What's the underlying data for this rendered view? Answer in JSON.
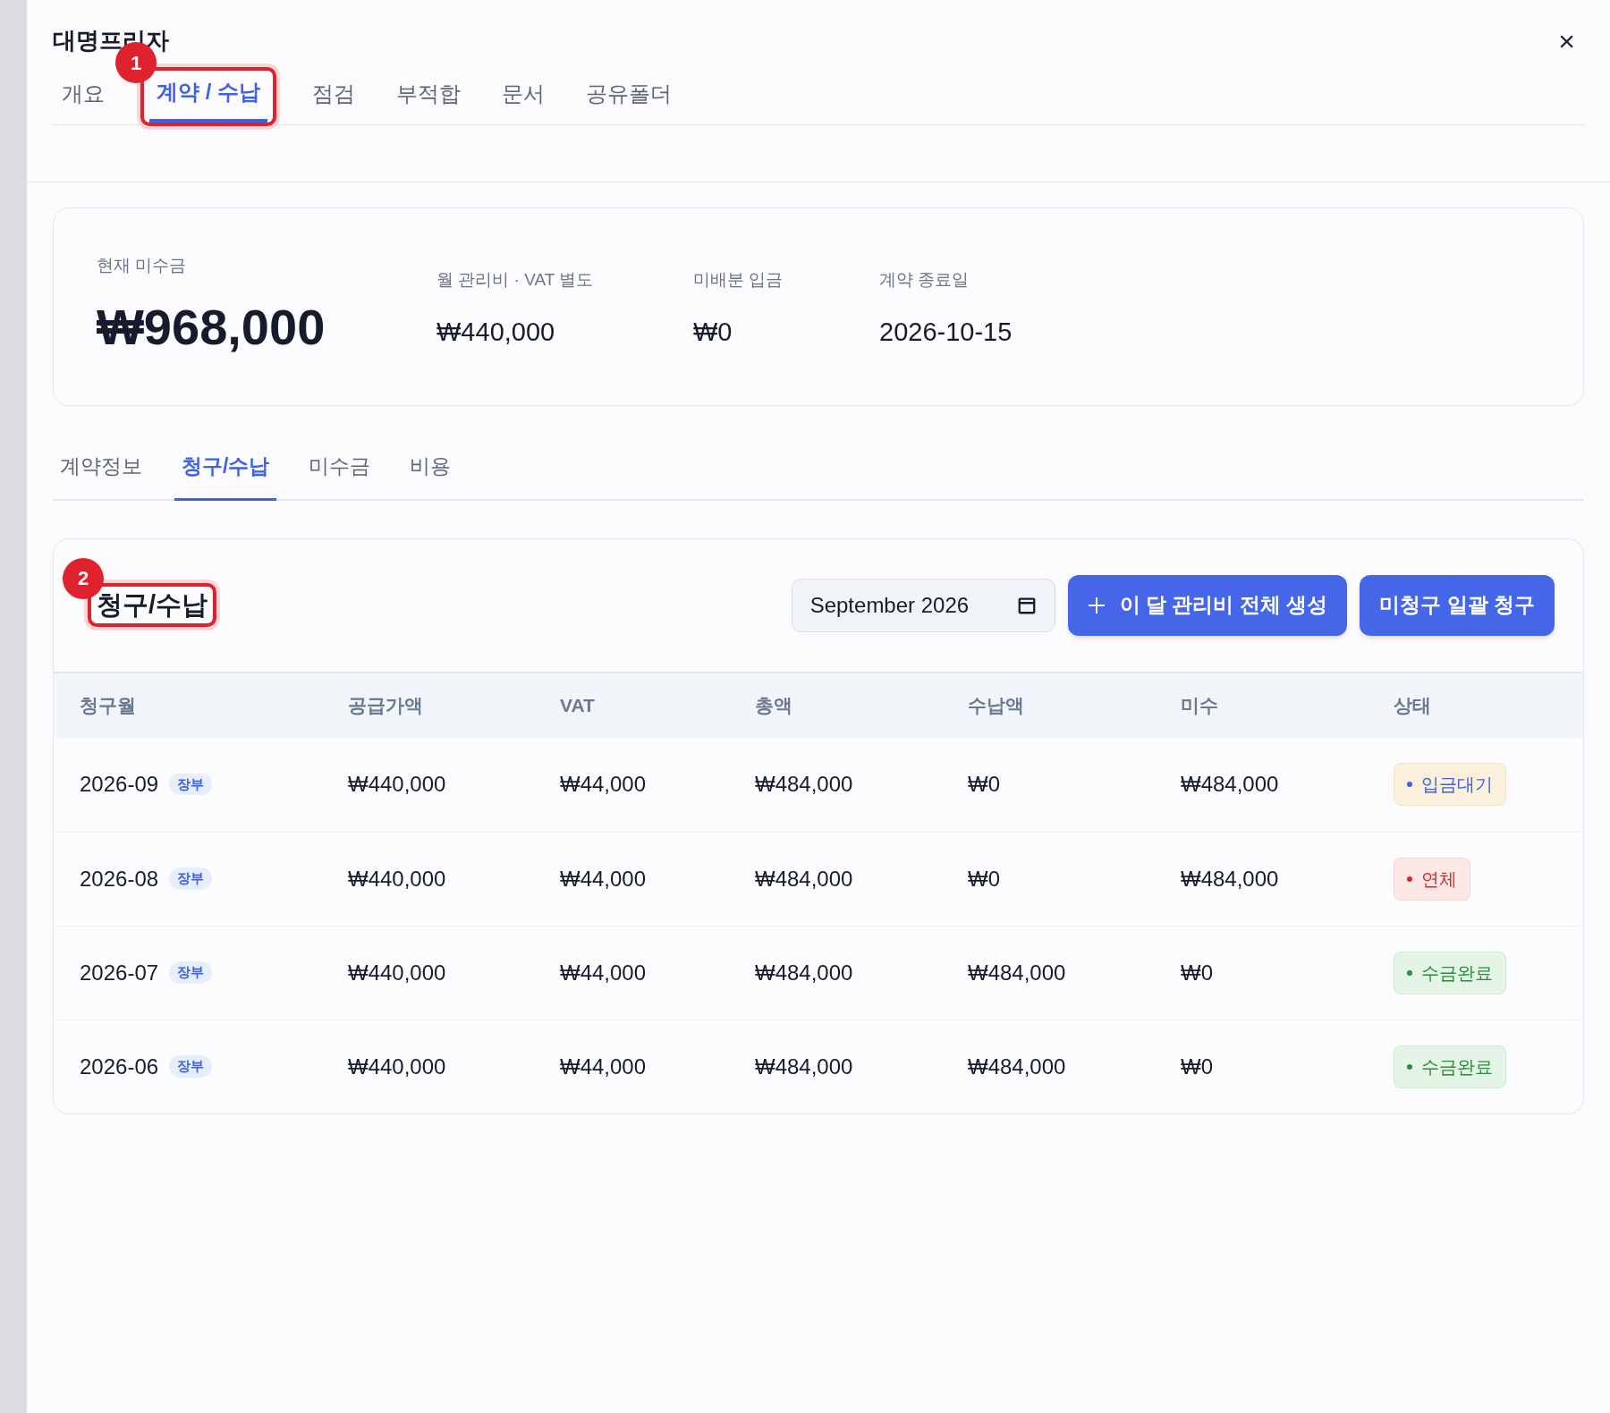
{
  "drawer": {
    "title": "대명프리자",
    "close": "×"
  },
  "tabs": [
    {
      "label": "개요",
      "selected": false
    },
    {
      "label": "계약 / 수납",
      "selected": true,
      "callout": "1"
    },
    {
      "label": "점검",
      "selected": false
    },
    {
      "label": "부적합",
      "selected": false
    },
    {
      "label": "문서",
      "selected": false
    },
    {
      "label": "공유폴더",
      "selected": false
    }
  ],
  "summary": {
    "main": {
      "label": "현재 미수금",
      "value": "₩968,000"
    },
    "items": [
      {
        "label": "월 관리비 · VAT 별도",
        "value": "₩440,000"
      },
      {
        "label": "미배분 입금",
        "value": "₩0"
      },
      {
        "label": "계약 종료일",
        "value": "2026-10-15"
      }
    ]
  },
  "subtabs": [
    {
      "label": "계약정보",
      "selected": false
    },
    {
      "label": "청구/수납",
      "selected": true
    },
    {
      "label": "미수금",
      "selected": false
    },
    {
      "label": "비용",
      "selected": false
    }
  ],
  "billing": {
    "title": "청구/수납",
    "callout": "2",
    "month": "September 2026",
    "buttons": [
      {
        "label": "이 달 관리비 전체 생성",
        "kind": "add"
      },
      {
        "label": "미청구 일괄 청구",
        "kind": "plain"
      }
    ],
    "table": {
      "columns": [
        "청구월",
        "공급가액",
        "VAT",
        "총액",
        "수납액",
        "미수",
        "상태"
      ],
      "rows": [
        {
          "month": "2026-09",
          "tag": "장부",
          "supply": "₩440,000",
          "vat": "₩44,000",
          "total": "₩484,000",
          "paid": "₩0",
          "due": "₩484,000",
          "status": {
            "label": "입금대기",
            "kind": "pending"
          }
        },
        {
          "month": "2026-08",
          "tag": "장부",
          "supply": "₩440,000",
          "vat": "₩44,000",
          "total": "₩484,000",
          "paid": "₩0",
          "due": "₩484,000",
          "status": {
            "label": "연체",
            "kind": "overdue"
          }
        },
        {
          "month": "2026-07",
          "tag": "장부",
          "supply": "₩440,000",
          "vat": "₩44,000",
          "total": "₩484,000",
          "paid": "₩484,000",
          "due": "₩0",
          "status": {
            "label": "수금완료",
            "kind": "paid"
          }
        },
        {
          "month": "2026-06",
          "tag": "장부",
          "supply": "₩440,000",
          "vat": "₩44,000",
          "total": "₩484,000",
          "paid": "₩484,000",
          "due": "₩0",
          "status": {
            "label": "수금완료",
            "kind": "paid"
          }
        }
      ]
    }
  }
}
